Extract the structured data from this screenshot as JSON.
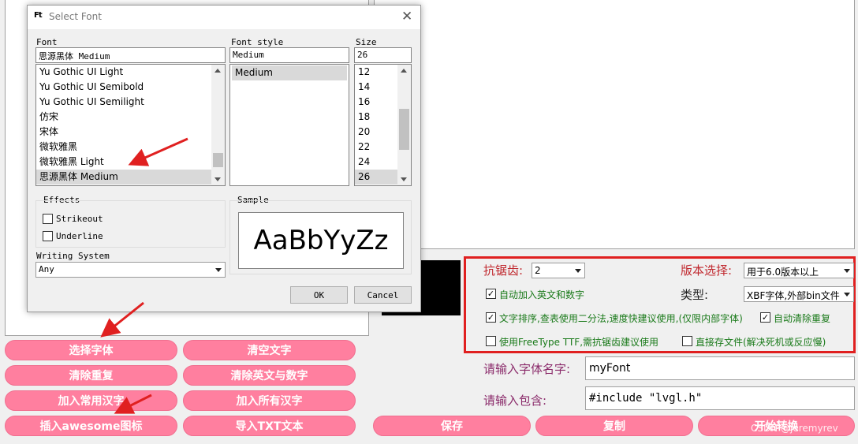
{
  "main": {
    "buttons_left": [
      {
        "label": "选择字体"
      },
      {
        "label": "清空文字"
      },
      {
        "label": "清除重复"
      },
      {
        "label": "清除英文与数字"
      },
      {
        "label": "加入常用汉字"
      },
      {
        "label": "加入所有汉字"
      },
      {
        "label": "插入awesome图标"
      },
      {
        "label": "导入TXT文本"
      }
    ],
    "buttons_right": [
      {
        "label": "保存"
      },
      {
        "label": "复制"
      },
      {
        "label": "开始转换"
      }
    ],
    "watermark": "CSDN @jeremyrev"
  },
  "options": {
    "antialias_label": "抗锯齿:",
    "antialias_value": "2",
    "version_label": "版本选择:",
    "version_value": "用于6.0版本以上",
    "type_label": "类型:",
    "type_value": "XBF字体,外部bin文件",
    "auto_add_label": "自动加入英文和数字",
    "auto_add_checked": true,
    "sort_label": "文字排序,查表使用二分法,速度快建议使用,(仅限内部字体)",
    "sort_checked": true,
    "auto_dedupe_label": "自动清除重复",
    "auto_dedupe_checked": true,
    "freetype_label": "使用FreeType TTF,需抗锯齿建议使用",
    "freetype_checked": false,
    "direct_save_label": "直接存文件(解决死机或反应慢)",
    "direct_save_checked": false,
    "font_name_label": "请输入字体名字:",
    "font_name_value": "myFont",
    "include_label": "请输入包含:",
    "include_value": "#include \"lvgl.h\""
  },
  "dialog": {
    "title": "Select Font",
    "app_icon": "Ft",
    "close_icon": "close-icon",
    "font_label": "Font",
    "font_value": "思源黑体 Medium",
    "font_list": [
      {
        "label": "Yu Gothic UI Light"
      },
      {
        "label": "Yu Gothic UI Semibold"
      },
      {
        "label": "Yu Gothic UI Semilight"
      },
      {
        "label": "仿宋"
      },
      {
        "label": "宋体"
      },
      {
        "label": "微软雅黑"
      },
      {
        "label": "微软雅黑 Light"
      },
      {
        "label": "思源黑体 Medium"
      }
    ],
    "style_label": "Font style",
    "style_value": "Medium",
    "style_list": [
      {
        "label": "Medium"
      }
    ],
    "size_label": "Size",
    "size_value": "26",
    "size_list": [
      {
        "label": "12"
      },
      {
        "label": "14"
      },
      {
        "label": "16"
      },
      {
        "label": "18"
      },
      {
        "label": "20"
      },
      {
        "label": "22"
      },
      {
        "label": "24"
      },
      {
        "label": "26"
      }
    ],
    "effects_label": "Effects",
    "strikeout_label": "Strikeout",
    "underline_label": "Underline",
    "sample_label": "Sample",
    "sample_text": "AaBbYyZz",
    "writing_system_label": "Writing System",
    "writing_system_value": "Any",
    "ok_label": "OK",
    "cancel_label": "Cancel"
  },
  "colors": {
    "pink_button": "#ff7f9f",
    "highlight_box": "#e02020",
    "annotation_arrow": "#e02020"
  }
}
